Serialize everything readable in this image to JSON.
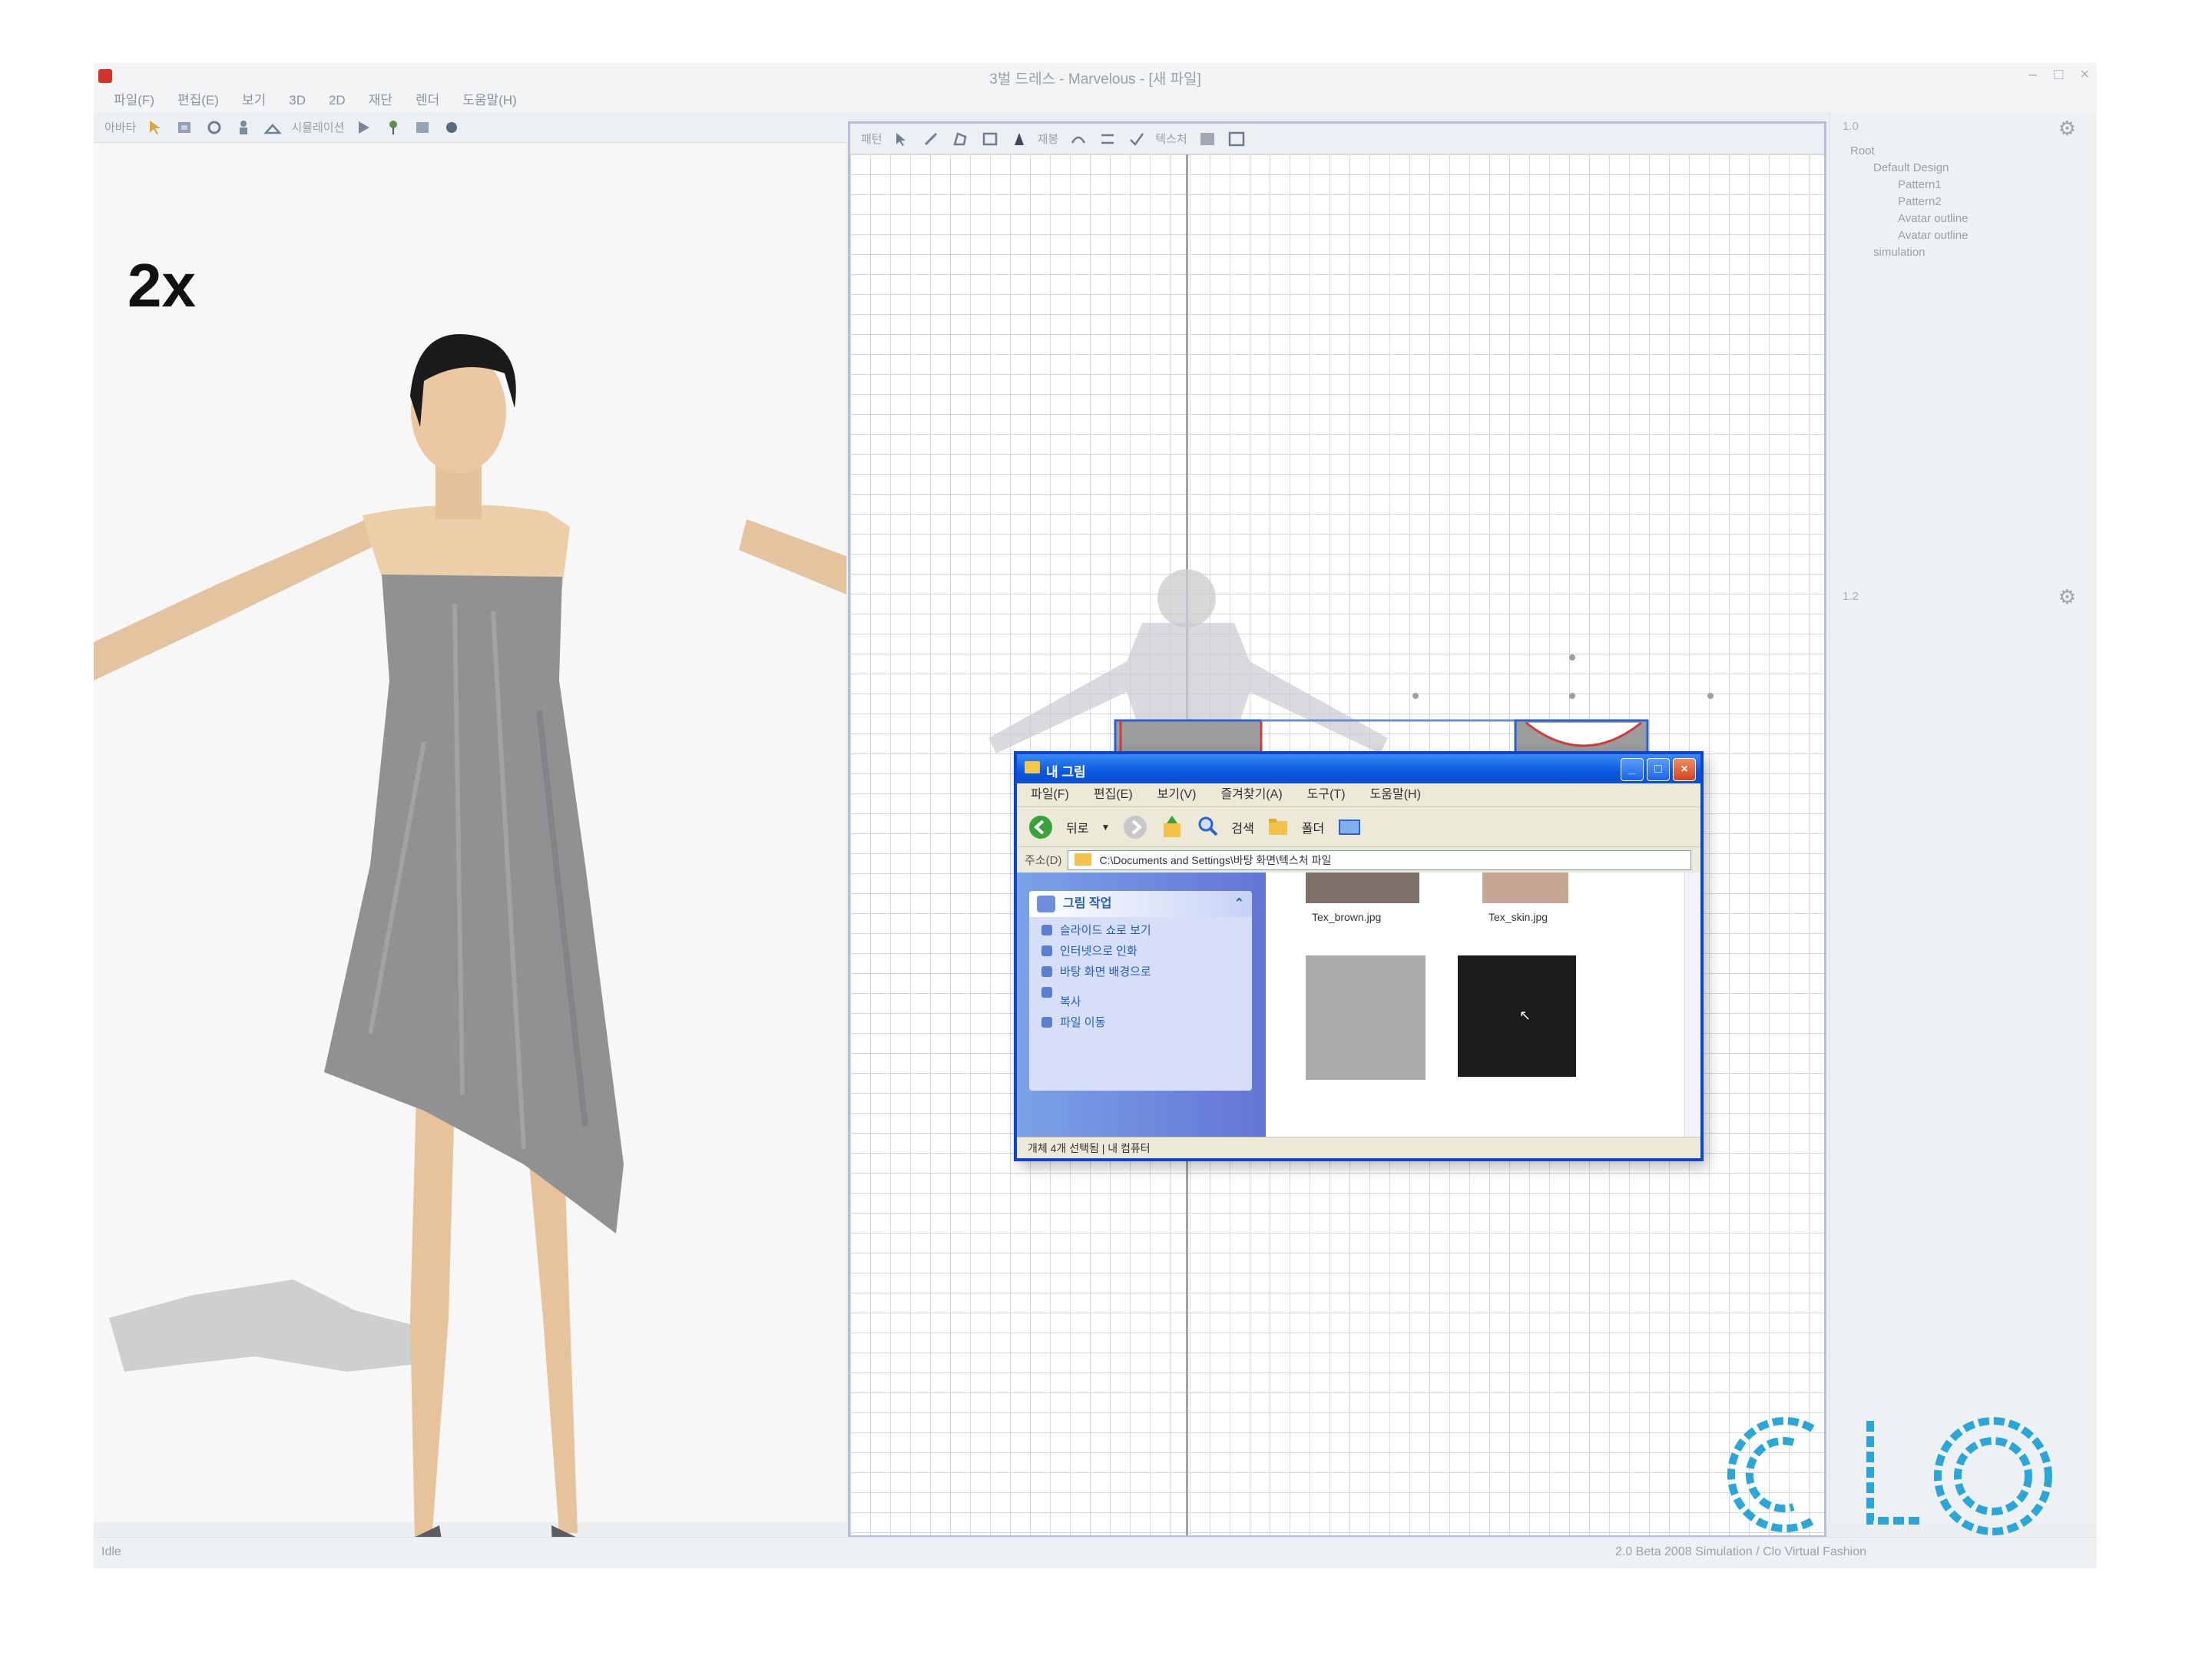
{
  "app": {
    "window_title": "3벌 드레스 - Marvelous - [새 파일]",
    "menu": [
      "파일(F)",
      "편집(E)",
      "보기",
      "3D",
      "2D",
      "재단",
      "렌더",
      "도움말(H)"
    ]
  },
  "toolbar3d": {
    "label_a": "아바타",
    "label_b": "시뮬레이션"
  },
  "toolbar2d": {
    "label_a": "패턴",
    "label_b": "재봉",
    "label_c": "텍스처"
  },
  "view3d": {
    "speed_label": "2x"
  },
  "object_tree": {
    "items": [
      "Root",
      "Default Design",
      "Pattern1",
      "Pattern2",
      "Avatar outline",
      "Avatar outline",
      "simulation"
    ]
  },
  "right_panel": {
    "value_a": "1.0",
    "value_b": "1.2"
  },
  "statusbar": {
    "left_text": "Idle",
    "right_text": "2.0 Beta 2008 Simulation / Clo Virtual Fashion"
  },
  "explorer": {
    "title": "내 그림",
    "menu": [
      "파일(F)",
      "편집(E)",
      "보기(V)",
      "즐겨찾기(A)",
      "도구(T)",
      "도움말(H)"
    ],
    "back_label": "뒤로",
    "search_label": "검색",
    "folders_label": "폴더",
    "address_label": "주소(D)",
    "address_value": "C:\\Documents and Settings\\바탕 화면\\텍스처 파일",
    "task_header": "그림 작업",
    "tasks": [
      "슬라이드 쇼로 보기",
      "인터넷으로 인화",
      "바탕 화면 배경으로",
      "복사",
      "파일 이동"
    ],
    "files": [
      {
        "name": "Tex_brown.jpg",
        "color": "#7d7068"
      },
      {
        "name": "Tex_skin.jpg",
        "color": "#c6a694"
      },
      {
        "name": "",
        "color": "#a9aaac"
      },
      {
        "name": "",
        "color": "#1c1c1c"
      }
    ],
    "status_text": "개체 4개 선택됨 | 내 컴퓨터",
    "status_right": "내 컴퓨터"
  },
  "brand": {
    "logo_text": "CLO",
    "logo_color": "#2aa6d8"
  },
  "colors": {
    "dress": "#8e9092",
    "skin": "#e4c7a2",
    "avatar_silhouette": "#c9cbce",
    "pattern_fill": "#9a9c9e",
    "xp_blue": "#0a46d4"
  }
}
